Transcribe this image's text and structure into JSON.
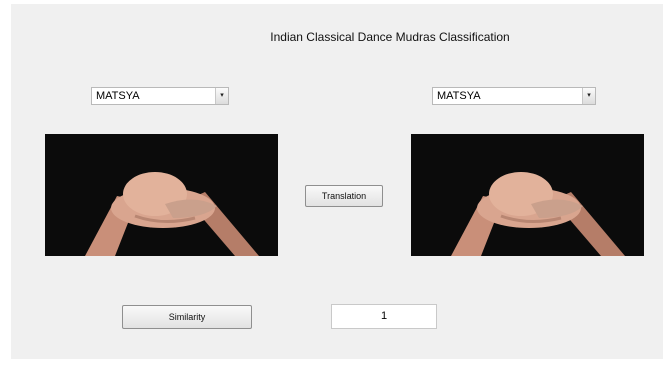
{
  "title": "Indian Classical Dance Mudras Classification",
  "left_dropdown": {
    "selected": "MATSYA",
    "icon": "dropdown-arrow-icon"
  },
  "right_dropdown": {
    "selected": "MATSYA",
    "icon": "dropdown-arrow-icon"
  },
  "left_image": {
    "description_icon": "hand-mudra-photo"
  },
  "right_image": {
    "description_icon": "hand-mudra-photo"
  },
  "buttons": {
    "translation": "Translation",
    "similarity": "Similarity"
  },
  "similarity_output": "1",
  "colors": {
    "panel": "#f0f0f0",
    "image_bg": "#0b0b0b",
    "skin": "#d9a58f"
  }
}
